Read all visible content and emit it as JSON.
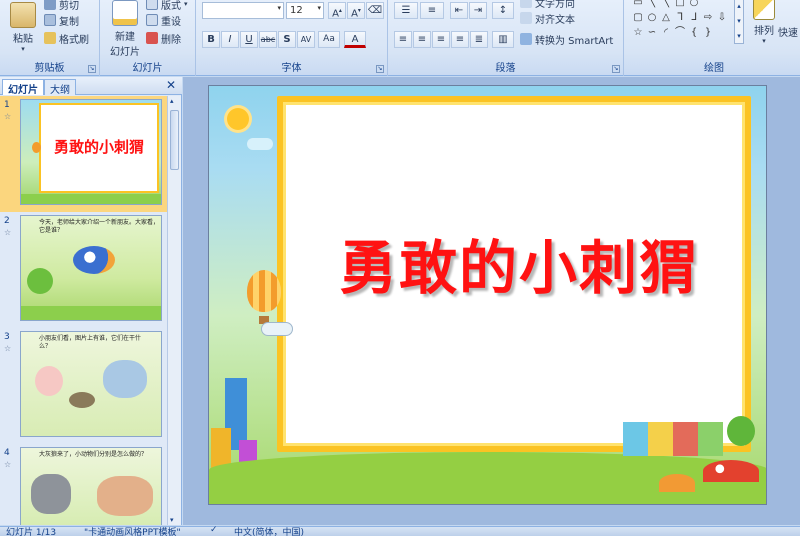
{
  "ribbon": {
    "clipboard": {
      "label": "剪贴板",
      "paste": "粘贴",
      "cut": "剪切",
      "copy": "复制",
      "format_painter": "格式刷"
    },
    "slides": {
      "label": "幻灯片",
      "new_slide_line1": "新建",
      "new_slide_line2": "幻灯片",
      "layout": "版式",
      "reset": "重设",
      "delete": "删除"
    },
    "font": {
      "label": "字体",
      "font_size": "12"
    },
    "paragraph": {
      "label": "段落",
      "text_direction": "文字方向",
      "align_text": "对齐文本",
      "smartart": "转换为 SmartArt"
    },
    "drawing": {
      "label": "绘图",
      "arrange": "排列",
      "quick_styles": "快速"
    }
  },
  "pane": {
    "tab_slides": "幻灯片",
    "tab_outline": "大纲",
    "close": "✕"
  },
  "thumbnails": [
    {
      "num": "1",
      "title": "勇敢的小刺猬"
    },
    {
      "num": "2",
      "text": "今天，老师给大家介绍一个新朋友。大家看，它是谁？"
    },
    {
      "num": "3",
      "text": "小朋友们看，图片上有谁，它们在干什么？"
    },
    {
      "num": "4",
      "text": "大灰狼来了，小动物们分别是怎么做的？"
    }
  ],
  "slide": {
    "title": "勇敢的小刺猬"
  },
  "status": {
    "slide_info": "幻灯片 1/13",
    "theme": "\"卡通动画风格PPT模板\"",
    "language": "中文(简体，中国)"
  },
  "colors": {
    "title_red": "#ff1212",
    "frame_yellow": "#fbc323",
    "ribbon_bg": "#d7e4f5",
    "selected": "#fbd67e"
  }
}
